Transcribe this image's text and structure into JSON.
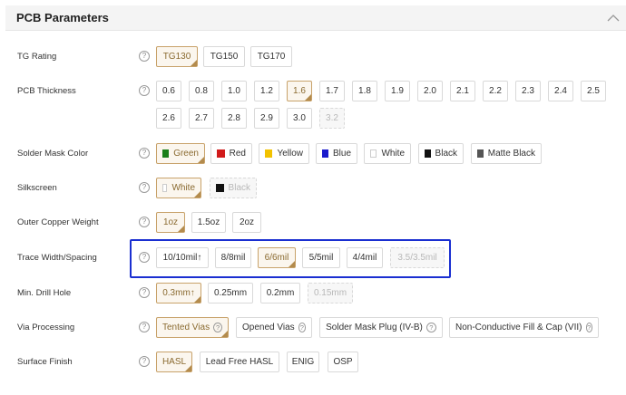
{
  "section_title": "PCB Parameters",
  "help_symbol": "?",
  "rows": {
    "tg": {
      "label": "TG Rating",
      "options": [
        "TG130",
        "TG150",
        "TG170"
      ]
    },
    "thickness": {
      "label": "PCB Thickness",
      "options": [
        "0.6",
        "0.8",
        "1.0",
        "1.2",
        "1.6",
        "1.7",
        "1.8",
        "1.9",
        "2.0",
        "2.1",
        "2.2",
        "2.3",
        "2.4",
        "2.5",
        "2.6",
        "2.7",
        "2.8",
        "2.9",
        "3.0",
        "3.2"
      ]
    },
    "mask": {
      "label": "Solder Mask Color",
      "options": [
        "Green",
        "Red",
        "Yellow",
        "Blue",
        "White",
        "Black",
        "Matte Black"
      ],
      "swatches": [
        "#1a7f1a",
        "#d11b1b",
        "#f2c200",
        "#1a1acc",
        "#ffffff",
        "#111111",
        "#555555"
      ]
    },
    "silk": {
      "label": "Silkscreen",
      "options": [
        "White",
        "Black"
      ],
      "swatches": [
        "#ffffff",
        "#111111"
      ]
    },
    "copper": {
      "label": "Outer Copper Weight",
      "options": [
        "1oz",
        "1.5oz",
        "2oz"
      ]
    },
    "trace": {
      "label": "Trace Width/Spacing",
      "options": [
        "10/10mil↑",
        "8/8mil",
        "6/6mil",
        "5/5mil",
        "4/4mil",
        "3.5/3.5mil"
      ]
    },
    "drill": {
      "label": "Min. Drill Hole",
      "options": [
        "0.3mm↑",
        "0.25mm",
        "0.2mm",
        "0.15mm"
      ]
    },
    "via": {
      "label": "Via Processing",
      "options": [
        "Tented Vias",
        "Opened Vias",
        "Solder Mask Plug (IV-B)",
        "Non-Conductive Fill & Cap (VII)"
      ]
    },
    "finish": {
      "label": "Surface Finish",
      "options": [
        "HASL",
        "Lead Free HASL",
        "ENIG",
        "OSP"
      ]
    }
  },
  "colors": {
    "selected_border": "#c8a26a",
    "highlight_box": "#1a2fd1"
  }
}
